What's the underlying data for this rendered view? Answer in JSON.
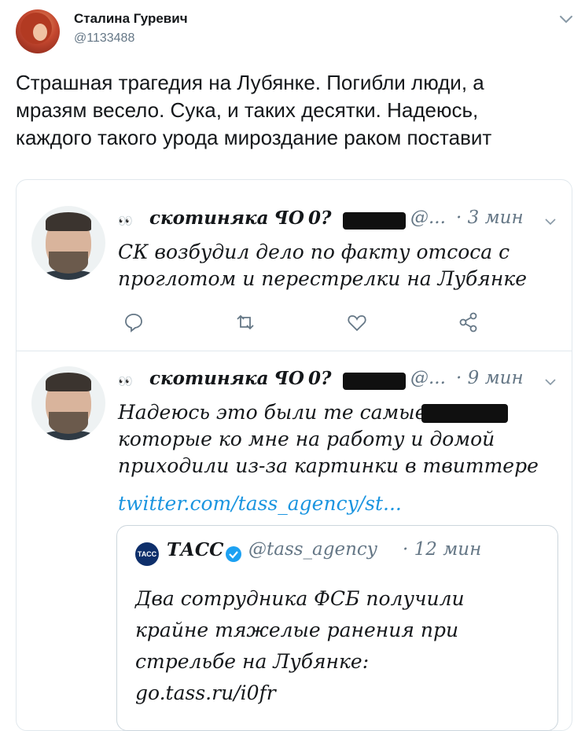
{
  "tweet": {
    "author_name": "Сталина Гуревич",
    "author_handle": "@1133488",
    "text": "Страшная трагедия на Лубянке. Погибли люди, а мразям весело. Сука, и таких десятки. Надеюсь, каждого такого урода мироздание раком поставит",
    "text_lines": [
      "Страшная трагедия на Лубянке. Погибли люди, а",
      "мразям весело. Сука, и таких десятки. Надеюсь,",
      "каждого такого урода мироздание раком поставит"
    ]
  },
  "embedded": [
    {
      "eyes": "👀",
      "name": "скотиняка ꟼО",
      "mark": "0?",
      "handle": "@...",
      "time": "· 3 мин",
      "text_lines": [
        "СК возбудил дело по факту отсоса с",
        "проглотом и перестрелки на Лубянке"
      ]
    },
    {
      "eyes": "👀",
      "name": "скотиняка ꟼО",
      "mark": "0?",
      "handle": "@...",
      "time": "· 9 мин",
      "text_lines": [
        "Надеюсь это были те самые",
        "которые ко мне на работу и домой",
        "приходили из-за картинки в твиттере"
      ],
      "link": "twitter.com/tass_agency/st...",
      "quote": {
        "logo": "ТАСС",
        "name": "ТАСС",
        "handle": "@tass_agency",
        "time": "· 12 мин",
        "text_lines": [
          "Два сотрудника ФСБ получили",
          "крайне тяжелые ранения при",
          "стрельбе на Лубянке:",
          "go.tass.ru/i0fr"
        ]
      }
    }
  ],
  "colors": {
    "text": "#14171a",
    "secondary": "#657786",
    "link": "#1b95e0",
    "border": "#e1e8ed"
  },
  "icons": [
    "chevron-down-icon",
    "reply-icon",
    "retweet-icon",
    "like-icon",
    "share-icon",
    "verified-icon",
    "eyes-icon"
  ]
}
